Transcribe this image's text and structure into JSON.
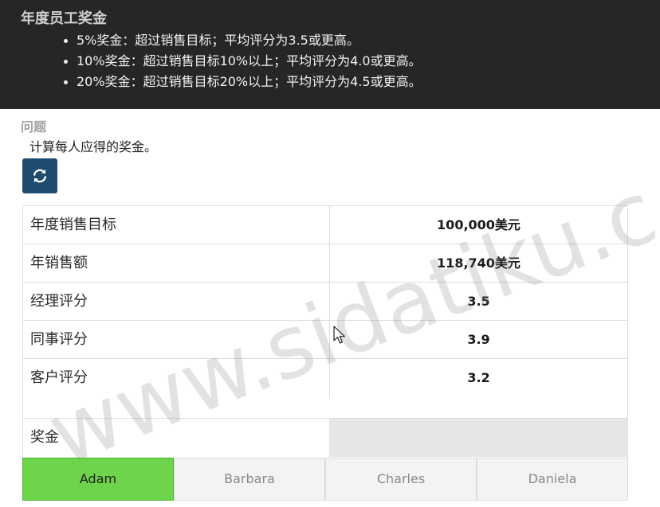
{
  "banner": {
    "title": "年度员工奖金",
    "items": [
      "5%奖金：超过销售目标；平均评分为3.5或更高。",
      "10%奖金：超过销售目标10%以上；平均评分为4.0或更高。",
      "20%奖金：超过销售目标20%以上；平均评分为4.5或更高。"
    ]
  },
  "question": {
    "heading": "问题",
    "text": "计算每人应得的奖金。"
  },
  "refresh_icon": "refresh-icon",
  "table": {
    "rows": [
      {
        "label": "年度销售目标",
        "value": "100,000美元"
      },
      {
        "label": "年销售额",
        "value": "118,740美元"
      },
      {
        "label": "经理评分",
        "value": "3.5"
      },
      {
        "label": "同事评分",
        "value": "3.9"
      },
      {
        "label": "客户评分",
        "value": "3.2"
      }
    ],
    "bonus_label": "奖金",
    "bonus_value": ""
  },
  "people": {
    "tabs": [
      "Adam",
      "Barbara",
      "Charles",
      "Daniela"
    ],
    "selected": "Adam"
  },
  "watermark": "www.sidatiku.com",
  "colors": {
    "banner_bg": "#262626",
    "refresh_button": "#1f4d72",
    "active_tab": "#6dd44c",
    "input_bg": "#e6e6e6"
  }
}
